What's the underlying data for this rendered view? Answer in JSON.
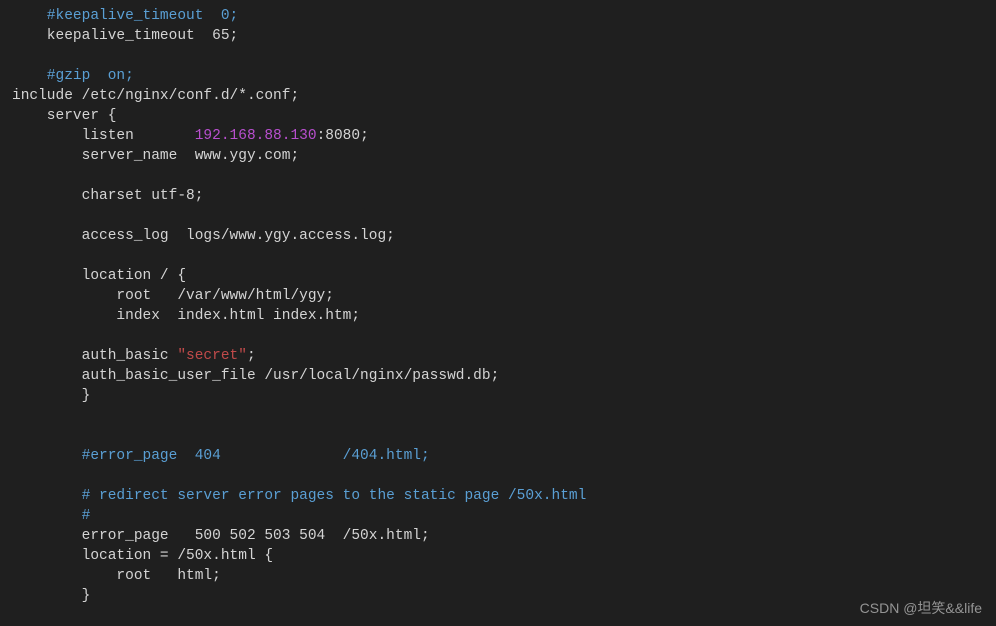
{
  "code": {
    "l1": "    #keepalive_timeout  0;",
    "l2": "    keepalive_timeout  65;",
    "l3": "",
    "l4": "    #gzip  on;",
    "l5": "include /etc/nginx/conf.d/*.conf;",
    "l6": "    server {",
    "l7a": "        listen       ",
    "l7b": "192.168.88.130",
    "l7c": ":8080;",
    "l8": "        server_name  www.ygy.com;",
    "l9": "",
    "l10": "        charset utf-8;",
    "l11": "",
    "l12": "        access_log  logs/www.ygy.access.log;",
    "l13": "",
    "l14": "        location / {",
    "l15": "            root   /var/www/html/ygy;",
    "l16": "            index  index.html index.htm;",
    "l17": "",
    "l18a": "        auth_basic ",
    "l18b": "\"secret\"",
    "l18c": ";",
    "l19": "        auth_basic_user_file /usr/local/nginx/passwd.db;",
    "l20": "        }",
    "l21": "",
    "l22": "",
    "l23": "        #error_page  404              /404.html;",
    "l24": "",
    "l25": "        # redirect server error pages to the static page /50x.html",
    "l26": "        #",
    "l27": "        error_page   500 502 503 504  /50x.html;",
    "l28": "        location = /50x.html {",
    "l29": "            root   html;",
    "l30": "        }"
  },
  "watermark": "CSDN @坦笑&&life"
}
